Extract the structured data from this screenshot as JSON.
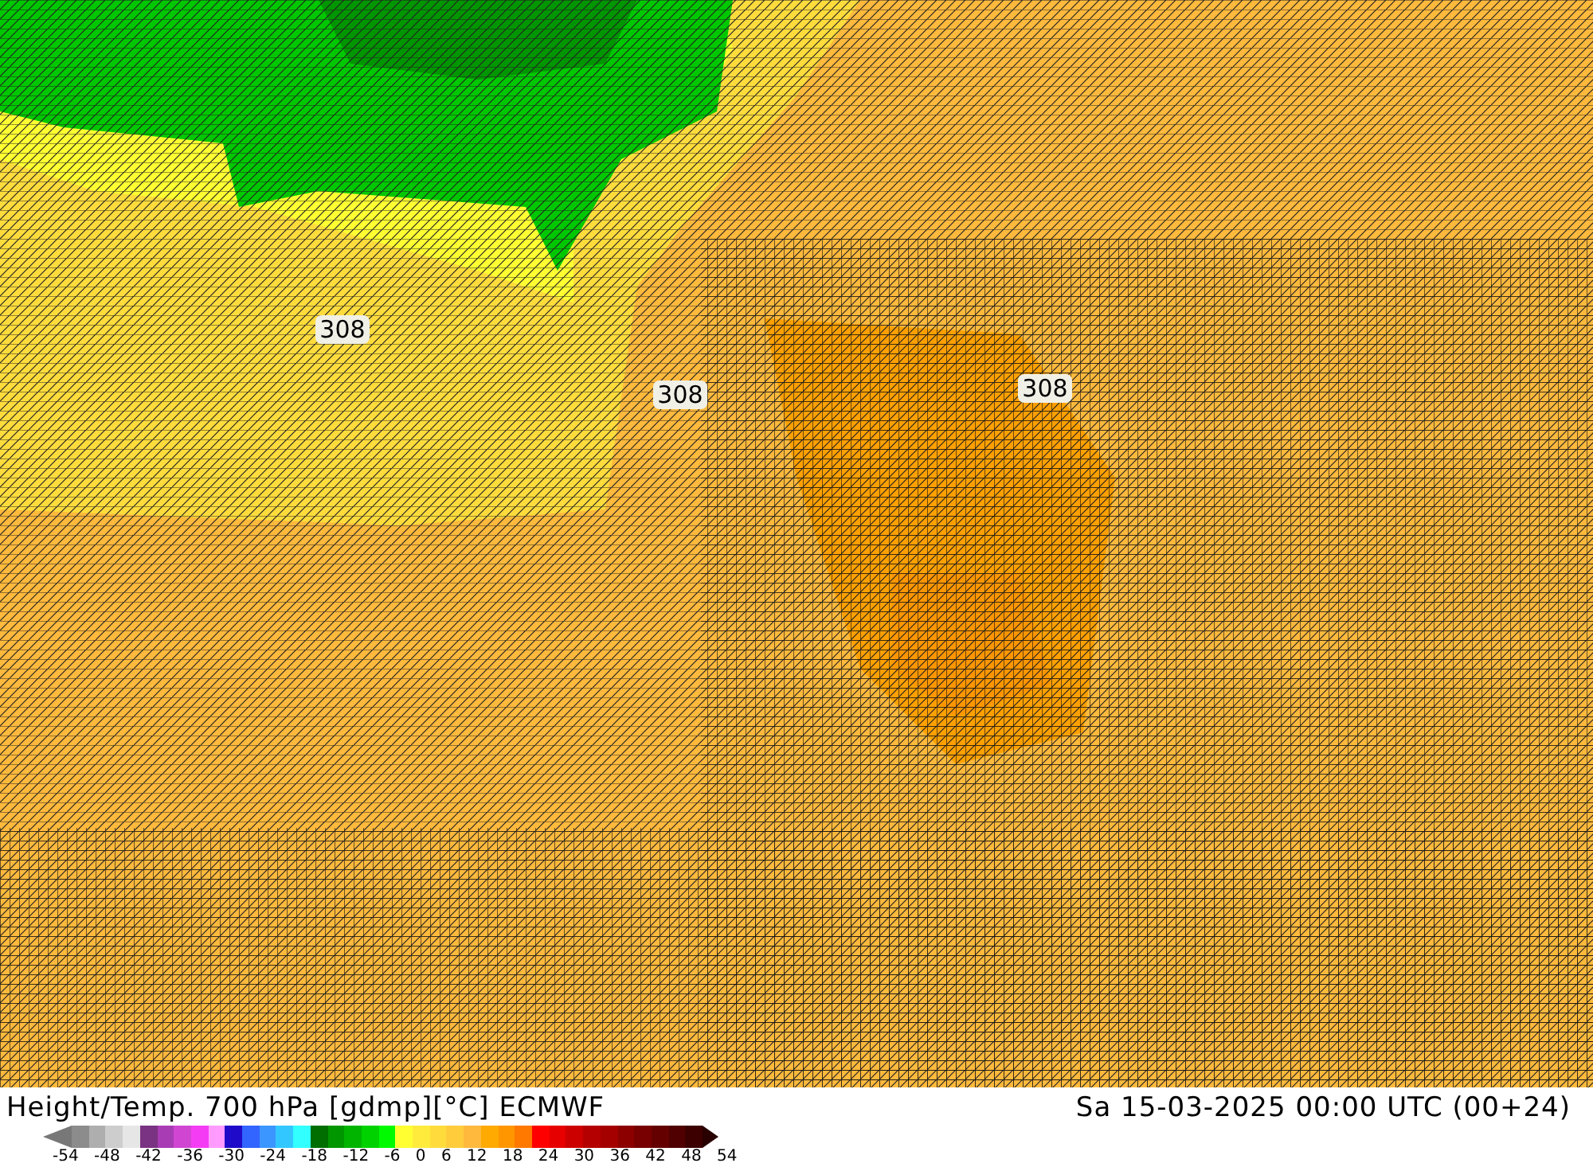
{
  "map": {
    "contour_labels": [
      "308",
      "308",
      "308"
    ]
  },
  "title": "Height/Temp. 700 hPa [gdmp][°C] ECMWF",
  "valid_time": "Sa 15-03-2025 00:00 UTC (00+24)",
  "legend": {
    "swatches": [
      {
        "color": "#8c8c8c"
      },
      {
        "color": "#aeaeae"
      },
      {
        "color": "#cdcdcd"
      },
      {
        "color": "#e6e6e6"
      },
      {
        "color": "#7a3282"
      },
      {
        "color": "#a83cb4"
      },
      {
        "color": "#d046d2"
      },
      {
        "color": "#f53cf5"
      },
      {
        "color": "#ff9bff"
      },
      {
        "color": "#1e0ac8"
      },
      {
        "color": "#3264ff"
      },
      {
        "color": "#3c96ff"
      },
      {
        "color": "#32c8ff"
      },
      {
        "color": "#32ffff"
      },
      {
        "color": "#006e00"
      },
      {
        "color": "#009600"
      },
      {
        "color": "#00b400"
      },
      {
        "color": "#00d200"
      },
      {
        "color": "#00fa00"
      },
      {
        "color": "#ffff32"
      },
      {
        "color": "#ffeb3c"
      },
      {
        "color": "#ffdc3c"
      },
      {
        "color": "#ffcd3c"
      },
      {
        "color": "#ffb93c"
      },
      {
        "color": "#ffaa00"
      },
      {
        "color": "#ff9600"
      },
      {
        "color": "#ff7800"
      },
      {
        "color": "#ff0000"
      },
      {
        "color": "#e60000"
      },
      {
        "color": "#cd0000"
      },
      {
        "color": "#b40000"
      },
      {
        "color": "#a50000"
      },
      {
        "color": "#8c0000"
      },
      {
        "color": "#780000"
      },
      {
        "color": "#640000"
      },
      {
        "color": "#500000"
      },
      {
        "color": "#3c0000"
      }
    ],
    "ticks": [
      "-54",
      "-48",
      "-42",
      "-36",
      "-30",
      "-24",
      "-18",
      "-12",
      "-6",
      "0",
      "6",
      "12",
      "18",
      "24",
      "30",
      "36",
      "42",
      "48",
      "54"
    ]
  }
}
